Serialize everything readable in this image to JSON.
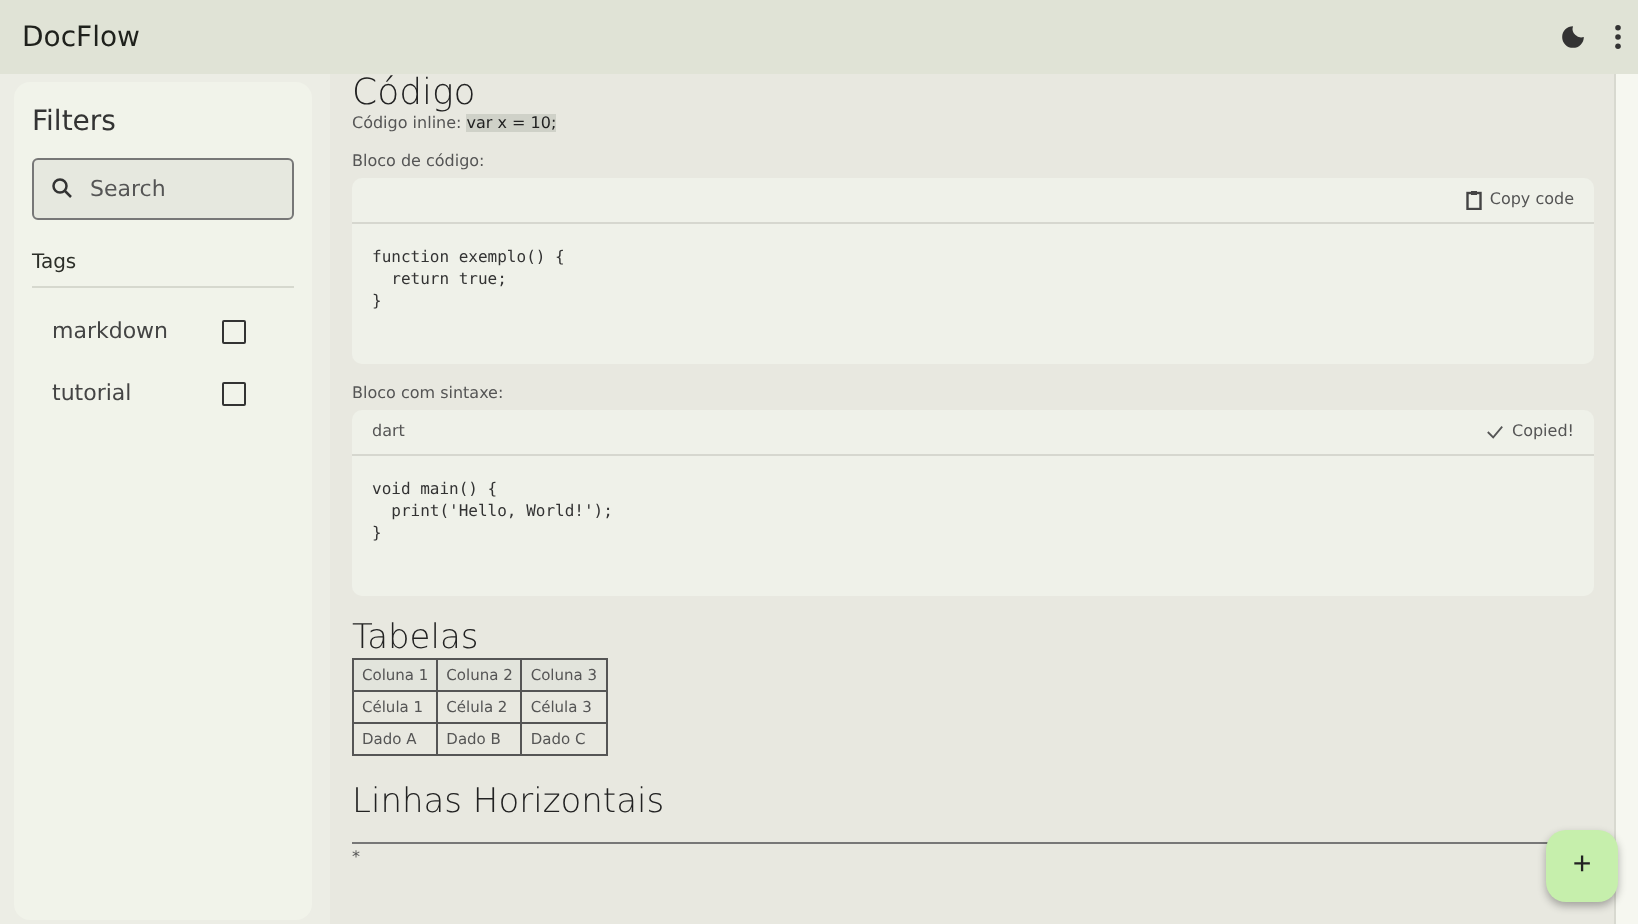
{
  "app_bar": {
    "title": "DocFlow"
  },
  "sidebar": {
    "title": "Filters",
    "search": {
      "placeholder": "Search"
    },
    "tags_label": "Tags",
    "tags": [
      {
        "label": "markdown",
        "checked": false
      },
      {
        "label": "tutorial",
        "checked": false
      }
    ]
  },
  "content": {
    "heading": "Código",
    "inline_label": "Código inline: ",
    "inline_code": "var x = 10;",
    "blocks": [
      {
        "label": "Bloco de código:",
        "action": {
          "label": "Copy code",
          "copied": false
        },
        "code": "function exemplo() {\n  return true;\n}"
      },
      {
        "label": "Bloco com sintaxe:",
        "language": "dart",
        "action": {
          "label": "Copied!",
          "copied": true
        },
        "code": "void main() {\n  print('Hello, World!');\n}"
      }
    ],
    "tables_heading": "Tabelas",
    "table": {
      "columns": [
        "Coluna 1",
        "Coluna 2",
        "Coluna 3"
      ],
      "rows": [
        [
          "Célula 1",
          "Célula 2",
          "Célula 3"
        ],
        [
          "Dado A",
          "Dado B",
          "Dado C"
        ]
      ]
    },
    "rules_heading": "Linhas Horizontais",
    "rule_note": "*"
  },
  "fab": {
    "label": "+"
  }
}
